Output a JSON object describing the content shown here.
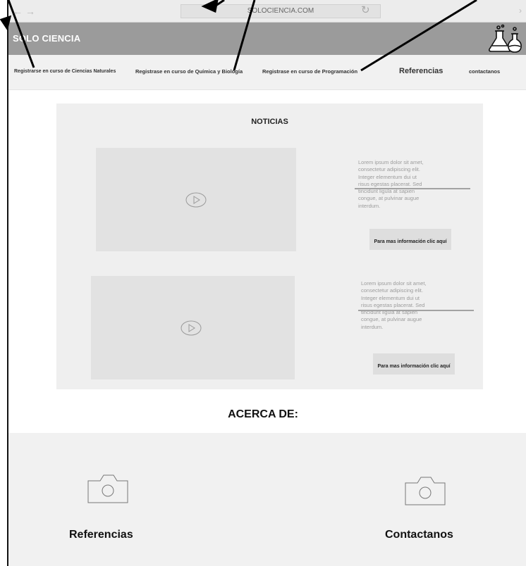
{
  "browser": {
    "back_icon": "arrow-left-icon",
    "forward_icon": "arrow-right-icon",
    "back_glyph": "←",
    "forward_glyph": "→",
    "address": "SOLOCIENCIA.COM",
    "reload_icon": "reload-icon",
    "reload_glyph": "↻",
    "menu_glyph": "›"
  },
  "header": {
    "title": "SOLO CIENCIA",
    "logo_icon": "flasks-icon"
  },
  "nav": {
    "items": [
      {
        "label": "Registrarse en curso de Ciencias Naturales"
      },
      {
        "label": "Registrase en curso de Química y Biología"
      },
      {
        "label": "Registrase en curso de Programación"
      },
      {
        "label": "Referencias"
      },
      {
        "label": "contactanos"
      }
    ]
  },
  "news": {
    "title": "NOTICIAS",
    "items": [
      {
        "text": "Lorem ipsum dolor sit amet, consectetur adipiscing elit. Integer elementum dui ut risus egestas placerat. Sed tincidunt ligula at sapien congue, at pulvinar augue interdum.",
        "button": "Para mas información clic aquí",
        "video_icon": "play-icon"
      },
      {
        "text": "Lorem ipsum dolor sit amet, consectetur adipiscing elit. Integer elementum dui ut risus egestas placerat. Sed tincidunt ligula at sapien congue, at pulvinar augue interdum.",
        "button": "Para mas información clic aquí",
        "video_icon": "play-icon"
      }
    ]
  },
  "about": {
    "title": "ACERCA DE:"
  },
  "footer": {
    "items": [
      {
        "label": "Referencias",
        "icon": "camera-icon"
      },
      {
        "label": "Contactanos",
        "icon": "camera-icon"
      }
    ]
  },
  "colors": {
    "title_bar": "#9b9b9b",
    "nav_bar": "#f1f1f1",
    "panel": "#efefef",
    "video": "#e2e2e2",
    "button": "#dedede"
  }
}
